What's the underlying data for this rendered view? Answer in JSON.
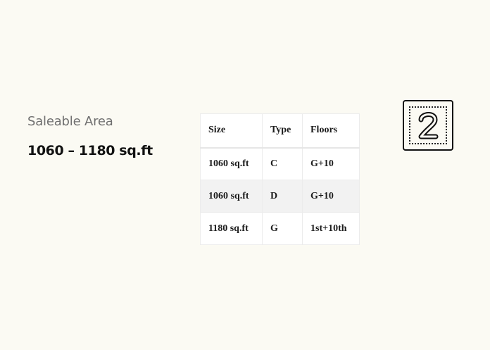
{
  "area": {
    "label": "Saleable Area",
    "value": "1060 – 1180 sq.ft"
  },
  "table": {
    "headers": [
      "Size",
      "Type",
      "Floors"
    ],
    "rows": [
      [
        "1060 sq.ft",
        "C",
        "G+10"
      ],
      [
        "1060 sq.ft",
        "D",
        "G+10"
      ],
      [
        "1180 sq.ft",
        "G",
        "1st+10th"
      ]
    ]
  },
  "badge": {
    "icon": "number-2-icon",
    "number": "2"
  },
  "colors": {
    "background": "#fbfaf3",
    "text": "#111111",
    "muted": "#6f6f6f",
    "row_alt": "#f2f2f2"
  }
}
